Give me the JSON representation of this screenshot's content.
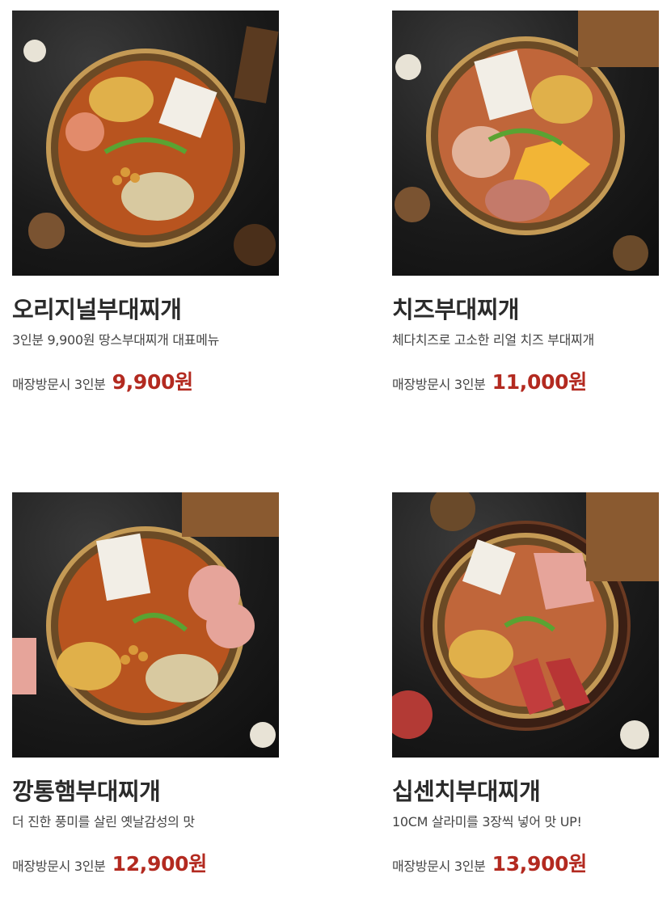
{
  "menu": {
    "items": [
      {
        "title": "오리지널부대찌개",
        "desc": "3인분 9,900원 땅스부대찌개 대표메뉴",
        "price_label": "매장방문시 3인분",
        "price": "9,900원",
        "image_icon": "food-photo-icon"
      },
      {
        "title": "치즈부대찌개",
        "desc": "체다치즈로 고소한 리얼 치즈 부대찌개",
        "price_label": "매장방문시 3인분",
        "price": "11,000원",
        "image_icon": "food-photo-icon"
      },
      {
        "title": "깡통햄부대찌개",
        "desc": "더 진한 풍미를 살린 옛날감성의 맛",
        "price_label": "매장방문시 3인분",
        "price": "12,900원",
        "image_icon": "food-photo-icon"
      },
      {
        "title": "십센치부대찌개",
        "desc": "10CM 살라미를 3장씩 넣어 맛 UP!",
        "price_label": "매장방문시 3인분",
        "price": "13,900원",
        "image_icon": "food-photo-icon"
      }
    ]
  },
  "colors": {
    "price": "#b32a20",
    "title": "#2b2b2b",
    "text": "#444444"
  }
}
